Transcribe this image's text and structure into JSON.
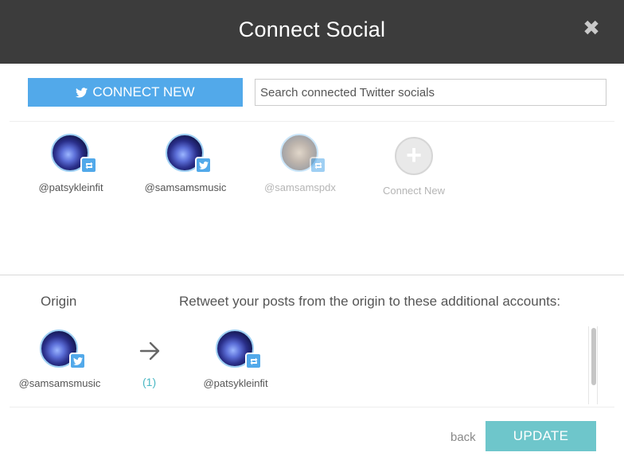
{
  "header": {
    "title": "Connect Social",
    "close_symbol": "✖"
  },
  "toolbar": {
    "connect_label": "CONNECT NEW",
    "search_placeholder": "Search connected Twitter socials"
  },
  "accounts": [
    {
      "handle": "@patsykleinfit",
      "badge": "retweet-icon",
      "faded": false
    },
    {
      "handle": "@samsamsmusic",
      "badge": "twitter-icon",
      "faded": false
    },
    {
      "handle": "@samsamspdx",
      "badge": "retweet-icon",
      "faded": true
    },
    {
      "label": "Connect New",
      "icon": "plus-icon"
    }
  ],
  "retweet": {
    "origin_label": "Origin",
    "targets_label": "Retweet your posts from the origin to these additional accounts:",
    "origin_handle": "@samsamsmusic",
    "count": "(1)",
    "target_handle": "@patsykleinfit"
  },
  "footer": {
    "back_label": "back",
    "update_label": "UPDATE"
  },
  "colors": {
    "header_bg": "#3c3c3c",
    "twitter_blue": "#52a9ea",
    "update_teal": "#6ec6cb",
    "count_teal": "#4ab8c4"
  }
}
